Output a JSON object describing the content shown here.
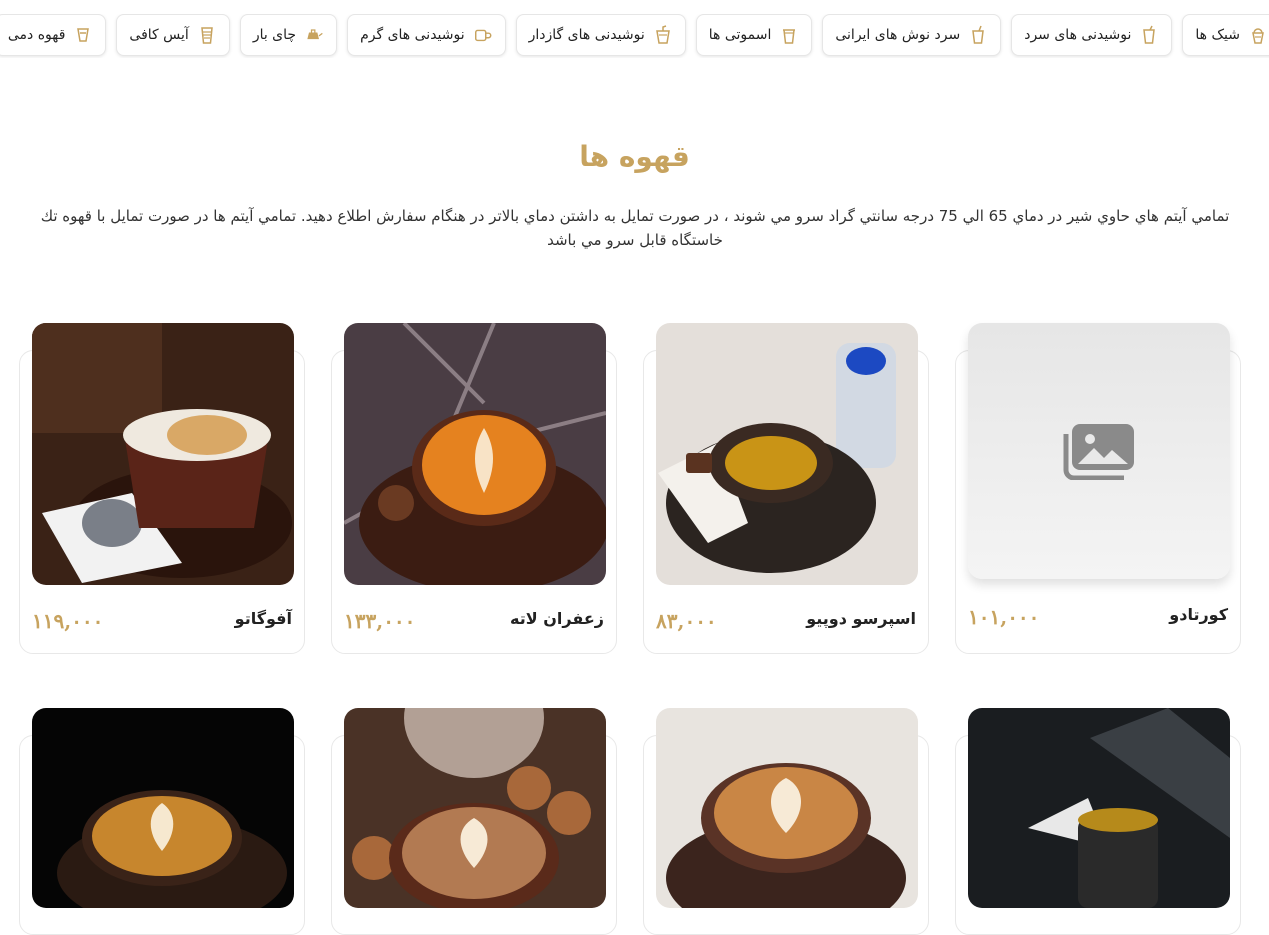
{
  "categories": [
    {
      "label": "قهوه دمی",
      "icon": "drip-coffee-icon"
    },
    {
      "label": "آیس کافی",
      "icon": "iced-coffee-icon"
    },
    {
      "label": "چای بار",
      "icon": "teapot-icon"
    },
    {
      "label": "نوشیدنی های گرم",
      "icon": "mug-icon"
    },
    {
      "label": "نوشیدنی های گازدار",
      "icon": "soda-cup-icon"
    },
    {
      "label": "اسموتی ها",
      "icon": "smoothie-icon"
    },
    {
      "label": "سرد نوش های ایرانی",
      "icon": "straw-cup-icon"
    },
    {
      "label": "نوشیدنی های سرد",
      "icon": "cold-cup-icon"
    },
    {
      "label": "شیک ها",
      "icon": "shake-icon"
    }
  ],
  "section": {
    "title": "قهوه ها",
    "description": "تمامي آيتم هاي حاوي شير در دماي 65 الي 75 درجه سانتي گراد سرو مي شوند ، در صورت تمايل به داشتن دماي بالاتر در هنگام سفارش اطلاع دهيد. تمامي آيتم ها در صورت تمايل با قهوه تك خاستگاه قابل سرو مي باشد"
  },
  "products": [
    {
      "name": "کورتادو",
      "price": "۱۰۱,۰۰۰",
      "image": "placeholder"
    },
    {
      "name": "اسپرسو دوپیو",
      "price": "۸۳,۰۰۰",
      "image": "espresso-photo"
    },
    {
      "name": "زعفران لاته",
      "price": "۱۳۳,۰۰۰",
      "image": "latte-art-photo"
    },
    {
      "name": "آفوگاتو",
      "price": "۱۱۹,۰۰۰",
      "image": "affogato-photo"
    }
  ],
  "row2_images": [
    "black-coffee-photo",
    "cappuccino-photo",
    "latte-cookies-photo",
    "latte-dark-photo"
  ],
  "colors": {
    "accent": "#c7a35f",
    "card_border": "#e8e8e8"
  }
}
